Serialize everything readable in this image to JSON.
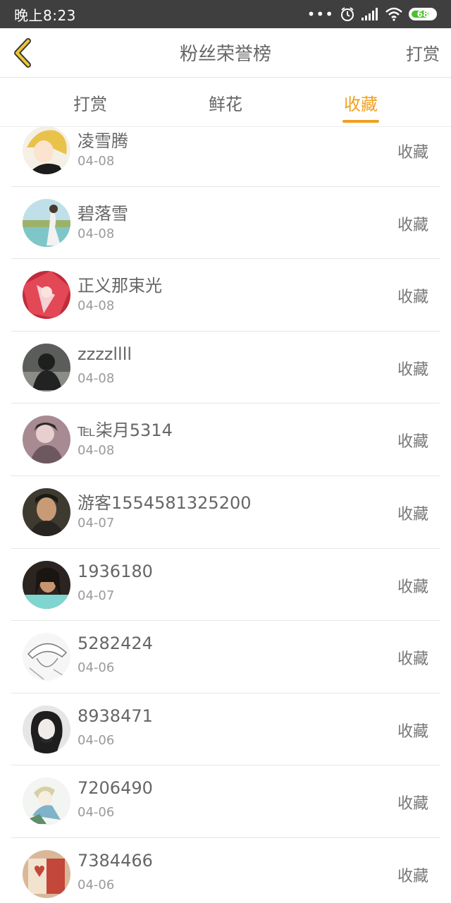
{
  "status": {
    "time": "晚上8:23",
    "battery": "68"
  },
  "header": {
    "title": "粉丝荣誉榜",
    "right_action": "打赏"
  },
  "tabs": [
    {
      "label": "打赏",
      "active": false
    },
    {
      "label": "鲜花",
      "active": false
    },
    {
      "label": "收藏",
      "active": true
    }
  ],
  "accent_color": "#f0a020",
  "rows": [
    {
      "name": "凌雪腾",
      "date": "04-08",
      "type": "收藏"
    },
    {
      "name": "碧落雪",
      "date": "04-08",
      "type": "收藏"
    },
    {
      "name": "正义那束光",
      "date": "04-08",
      "type": "收藏"
    },
    {
      "name": "zzzzllll",
      "date": "04-08",
      "type": "收藏"
    },
    {
      "name": "℡柒月5314",
      "date": "04-08",
      "type": "收藏"
    },
    {
      "name": "游客1554581325200",
      "date": "04-07",
      "type": "收藏"
    },
    {
      "name": "1936180",
      "date": "04-07",
      "type": "收藏"
    },
    {
      "name": "5282424",
      "date": "04-06",
      "type": "收藏"
    },
    {
      "name": "8938471",
      "date": "04-06",
      "type": "收藏"
    },
    {
      "name": "7206490",
      "date": "04-06",
      "type": "收藏"
    },
    {
      "name": "7384466",
      "date": "04-06",
      "type": "收藏"
    }
  ]
}
